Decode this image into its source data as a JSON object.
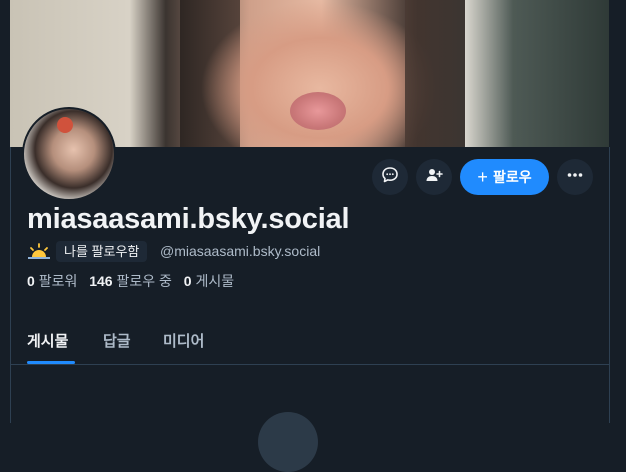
{
  "profile": {
    "display_name": "miasaasami.bsky.social",
    "handle": "@miasaasami.bsky.social",
    "follows_you_label": "나를 팔로우함",
    "stats": {
      "followers_count": "0",
      "followers_label": "팔로워",
      "following_count": "146",
      "following_label": "팔로우 중",
      "posts_count": "0",
      "posts_label": "게시물"
    }
  },
  "actions": {
    "message_icon": "chat-bubble-icon",
    "add_user_icon": "person-plus-icon",
    "follow_label": "팔로우",
    "more_icon": "ellipsis-icon"
  },
  "tabs": [
    {
      "label": "게시물",
      "active": true
    },
    {
      "label": "답글",
      "active": false
    },
    {
      "label": "미디어",
      "active": false
    }
  ],
  "colors": {
    "background": "#161e27",
    "accent": "#208bfe",
    "muted_text": "#aebbc9",
    "button_bg": "#1e2936"
  }
}
